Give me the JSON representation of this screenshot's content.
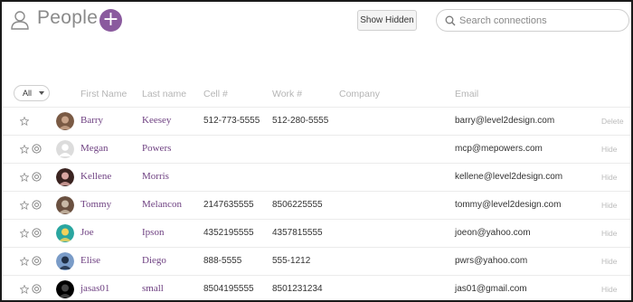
{
  "header": {
    "title": "People",
    "add_label": "+",
    "show_hidden_label": "Show Hidden",
    "search": {
      "placeholder": "Search connections",
      "value": ""
    }
  },
  "filter": {
    "selected": "All"
  },
  "columns": {
    "first_name": "First Name",
    "last_name": "Last name",
    "cell": "Cell #",
    "work": "Work #",
    "company": "Company",
    "email": "Email"
  },
  "colors": {
    "accent": "#8a5a9e",
    "name_link": "#6d3f80"
  },
  "rows": [
    {
      "first": "Barry",
      "last": "Keesey",
      "cell": "512-773-5555",
      "work": "512-280-5555",
      "company": "",
      "email": "barry@level2design.com",
      "action": "Delete",
      "has_hide_icon": false,
      "avatar": "photo"
    },
    {
      "first": "Megan",
      "last": "Powers",
      "cell": "",
      "work": "",
      "company": "",
      "email": "mcp@mepowers.com",
      "action": "Hide",
      "has_hide_icon": true,
      "avatar": "placeholder"
    },
    {
      "first": "Kellene",
      "last": "Morris",
      "cell": "",
      "work": "",
      "company": "",
      "email": "kellene@level2design.com",
      "action": "Hide",
      "has_hide_icon": true,
      "avatar": "photo"
    },
    {
      "first": "Tommy",
      "last": "Melancon",
      "cell": "2147635555",
      "work": "8506225555",
      "company": "",
      "email": "tommy@level2design.com",
      "action": "Hide",
      "has_hide_icon": true,
      "avatar": "photo"
    },
    {
      "first": "Joe",
      "last": "Ipson",
      "cell": "4352195555",
      "work": "4357815555",
      "company": "",
      "email": "joeon@yahoo.com",
      "action": "Hide",
      "has_hide_icon": true,
      "avatar": "photo"
    },
    {
      "first": "Elise",
      "last": "Diego",
      "cell": "888-5555",
      "work": "555-1212",
      "company": "",
      "email": "pwrs@yahoo.com",
      "action": "Hide",
      "has_hide_icon": true,
      "avatar": "photo"
    },
    {
      "first": "jasas01",
      "last": "small",
      "cell": "8504195555",
      "work": "8501231234",
      "company": "",
      "email": "jas01@gmail.com",
      "action": "Hide",
      "has_hide_icon": true,
      "avatar": "photo"
    }
  ]
}
